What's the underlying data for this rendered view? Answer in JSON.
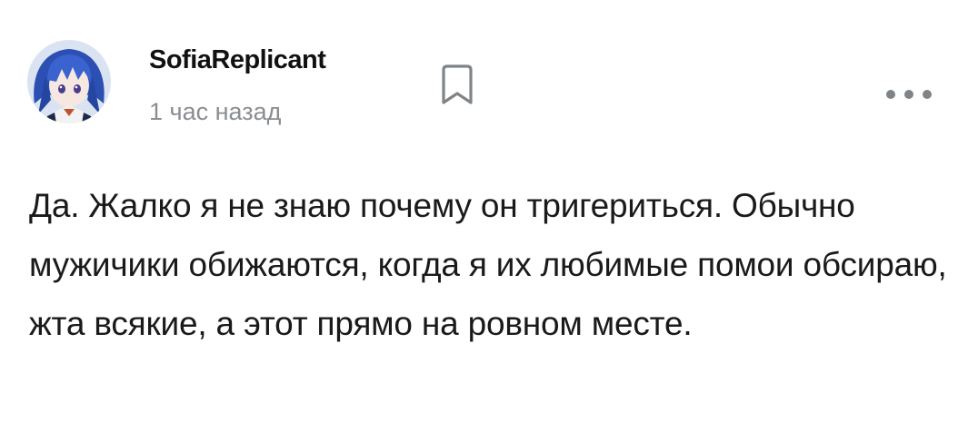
{
  "post": {
    "author": "SofiaReplicant",
    "time": "1 час назад",
    "text": "Да. Жалко я не знаю почему он тригериться. Обычно мужичики обижаются, когда я их любимые помои обсираю, жта всякие, а этот прямо на ровном месте.",
    "icons": {
      "bookmark": "bookmark-icon",
      "more": "more-horizontal-icon",
      "avatar": "user-avatar"
    },
    "colors": {
      "author": "#111111",
      "time": "#8a8d91",
      "icon": "#7f8489",
      "text": "#1a1a1a"
    }
  }
}
